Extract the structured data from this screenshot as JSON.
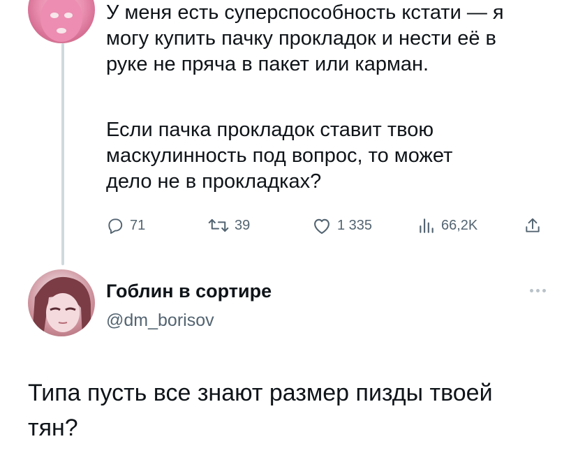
{
  "tweet": {
    "paragraph1": "У меня есть суперспособность кстати — я\nмогу купить пачку прокладок и нести её в\nруке не пряча в пакет или карман.",
    "paragraph2": "Если пачка прокладок ставит твою\nмаскулинность под вопрос, то может\nдело не в прокладках?",
    "actions": {
      "replies": "71",
      "retweets": "39",
      "likes": "1 335",
      "views": "66,2K"
    },
    "icons": [
      "reply-icon",
      "retweet-icon",
      "like-icon",
      "views-icon",
      "share-icon"
    ]
  },
  "reply": {
    "author_name": "Гоблин в сортире",
    "author_handle": "@dm_borisov",
    "text": "Типа пусть все знают размер пизды твоей\nтян?"
  },
  "colors": {
    "text": "#0f1419",
    "secondary": "#536471",
    "thread_line": "#cfd9de"
  }
}
